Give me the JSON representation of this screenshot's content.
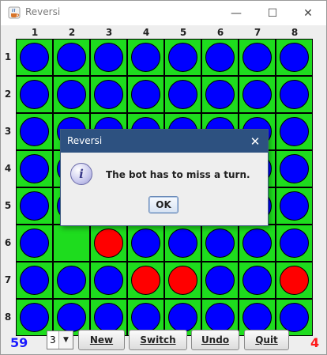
{
  "window": {
    "title": "Reversi",
    "minimize_glyph": "—",
    "maximize_glyph": "☐",
    "close_glyph": "✕",
    "app_icon": "java-cup-icon"
  },
  "board": {
    "columns": [
      "1",
      "2",
      "3",
      "4",
      "5",
      "6",
      "7",
      "8"
    ],
    "rows": [
      "1",
      "2",
      "3",
      "4",
      "5",
      "6",
      "7",
      "8"
    ],
    "colors": {
      "cell": "#1edc1e",
      "grid": "#000000",
      "blue": "#0000ff",
      "red": "#ff0000"
    },
    "cells": [
      [
        "blue",
        "blue",
        "blue",
        "blue",
        "blue",
        "blue",
        "blue",
        "blue"
      ],
      [
        "blue",
        "blue",
        "blue",
        "blue",
        "blue",
        "blue",
        "blue",
        "blue"
      ],
      [
        "blue",
        "blue",
        "blue",
        "blue",
        "blue",
        "blue",
        "blue",
        "blue"
      ],
      [
        "blue",
        "blue",
        "blue",
        "blue",
        "blue",
        "blue",
        "blue",
        "blue"
      ],
      [
        "blue",
        "blue",
        "blue",
        "blue",
        "blue",
        "blue",
        "blue",
        "blue"
      ],
      [
        "blue",
        "empty",
        "red",
        "blue",
        "blue",
        "blue",
        "blue",
        "blue"
      ],
      [
        "blue",
        "blue",
        "blue",
        "red",
        "red",
        "blue",
        "blue",
        "red"
      ],
      [
        "blue",
        "blue",
        "blue",
        "blue",
        "blue",
        "blue",
        "blue",
        "blue"
      ]
    ]
  },
  "footer": {
    "blue_score": "59",
    "red_score": "4",
    "level_select": {
      "value": "3"
    },
    "buttons": {
      "new": "New",
      "switch": "Switch",
      "undo": "Undo",
      "quit": "Quit"
    }
  },
  "dialog": {
    "title": "Reversi",
    "message": "The bot has to miss a turn.",
    "ok_label": "OK",
    "close_glyph": "✕",
    "icon": "information-icon"
  }
}
